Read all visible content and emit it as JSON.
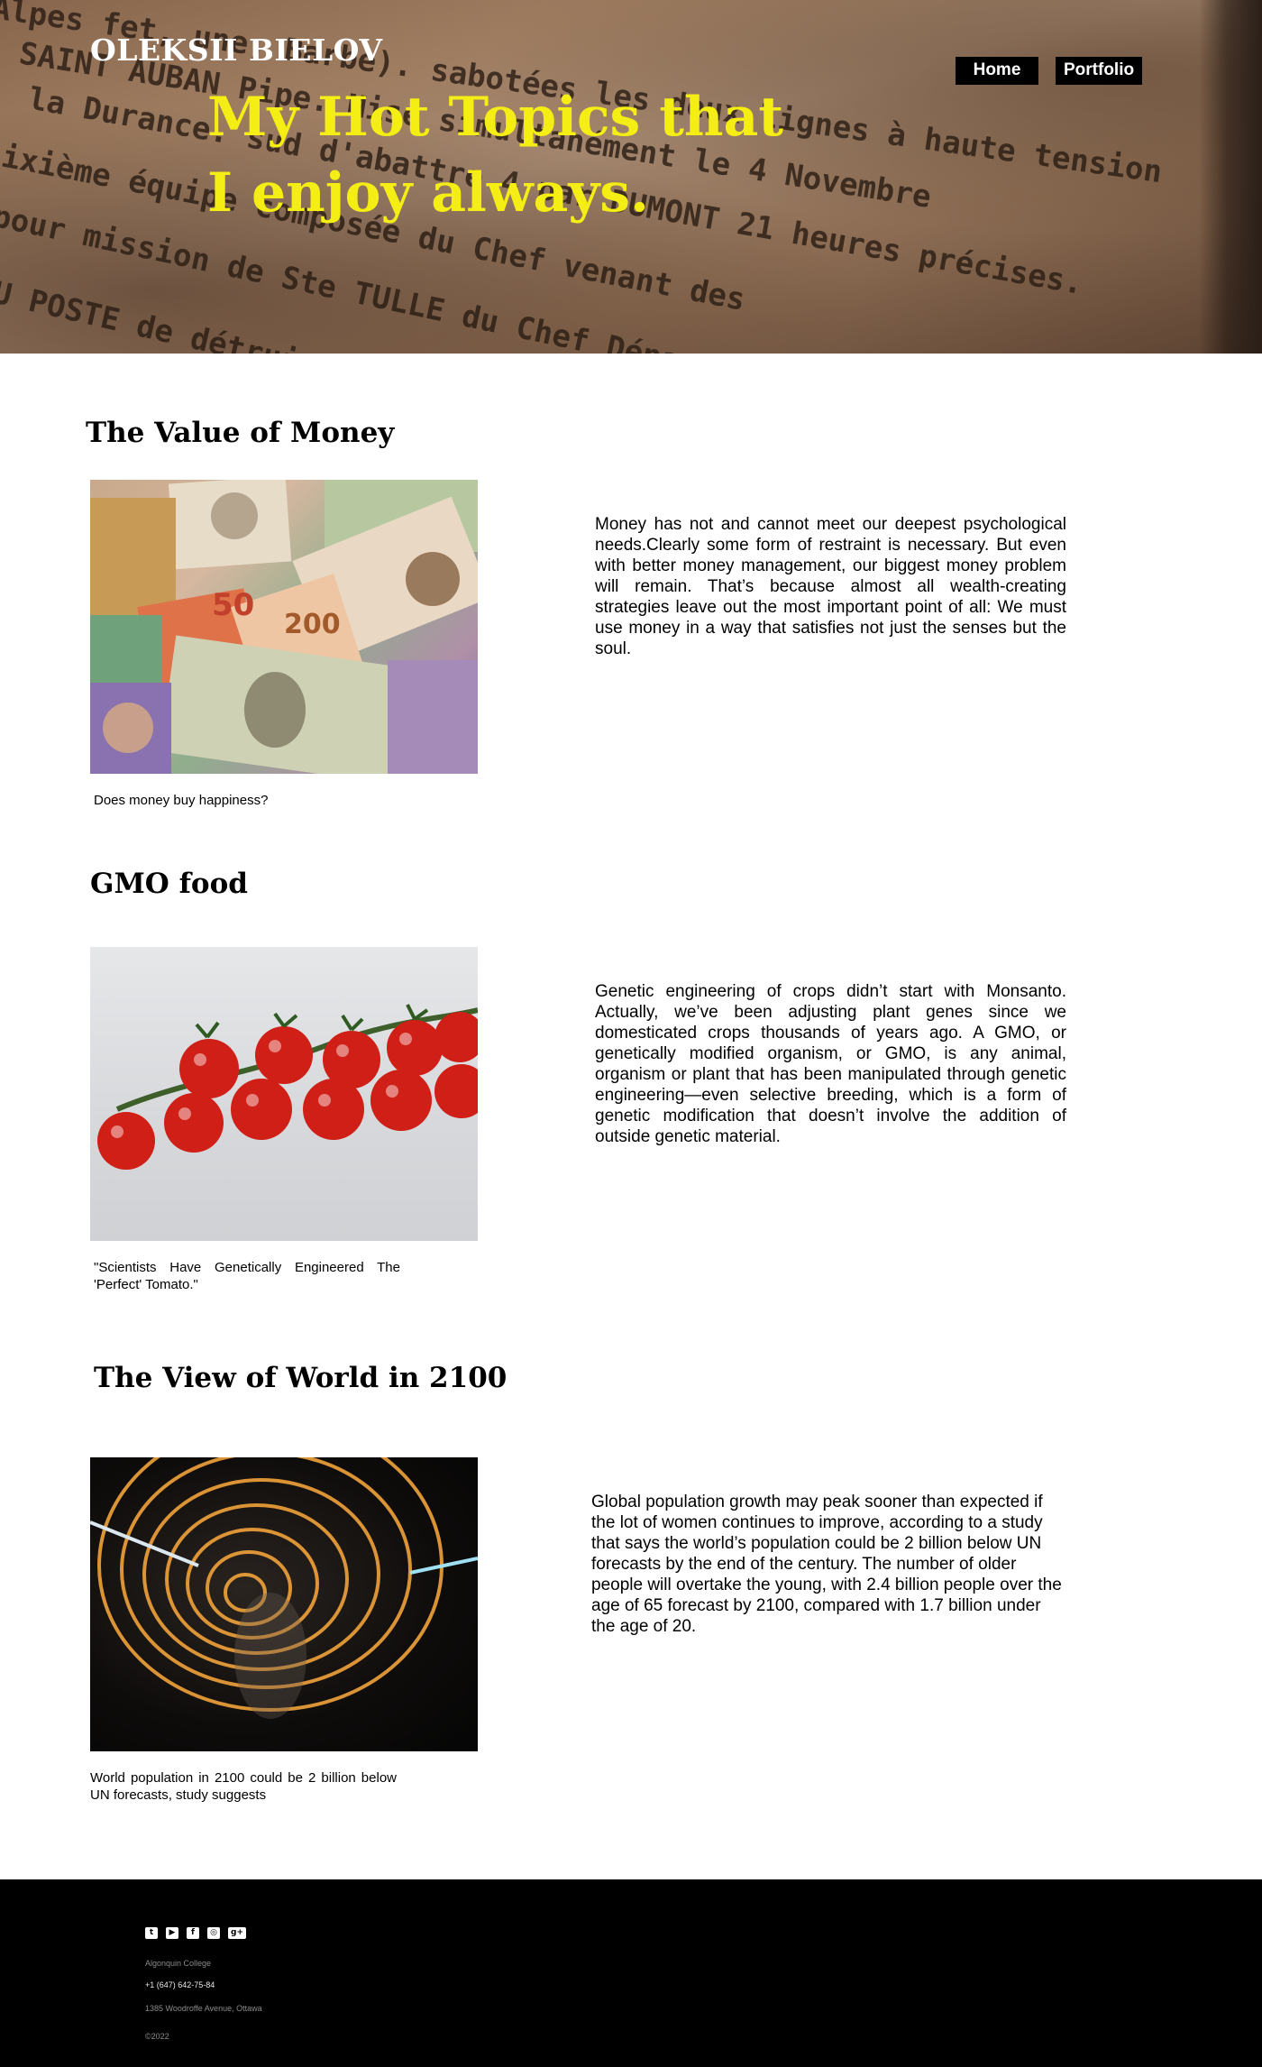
{
  "header": {
    "site_name": "OLEKSII BIELOV",
    "title_line1": "My Hot Topics that",
    "title_line2": "I enjoy always.",
    "background_text": [
      "Alpes fet, une, Barbe). sabotées les deux lignes à haute tension",
      "SAINT AUBAN Pipe. Mise simultanément le 4 Novembre",
      "la Durance. sud d'abattre 4 par DUMONT 21 heures précises.",
      "sixième équipe composée du Chef venant des",
      "pour mission de Ste TULLE du Chef Département sur la ligne",
      "DU POSTE de détruire l'endroit où la ligne"
    ],
    "nav": [
      {
        "label": "Home"
      },
      {
        "label": "Portfolio"
      }
    ],
    "title_color": "#f4ee14"
  },
  "topics": [
    {
      "heading": "The Value of Money",
      "image_name": "money-banknotes-image",
      "caption": "Does money buy happiness?",
      "body": "Money has not and cannot meet our deepest psychological needs.Clearly some form of restraint is necessary. But even with better money management, our biggest money problem will remain. That’s because almost all wealth-creating strategies leave out the most important point of all: We must use money in a way that satisfies not just the senses but the soul."
    },
    {
      "heading": "GMO food",
      "image_name": "cherry-tomatoes-image",
      "caption": "\"Scientists Have Genetically Engineered The 'Perfect' Tomato.\"",
      "body": "Genetic engineering of crops didn’t start with Monsanto. Actually, we’ve been adjusting plant genes since we domesticated crops thousands of years ago. A GMO, or genetically modified organism, or GMO, is any animal, organism or plant that has been manipulated through genetic engineering—even selective breeding, which is a form of genetic modification that doesn’t involve the addition of outside genetic material."
    },
    {
      "heading": "The View of World in 2100",
      "image_name": "light-spiral-image",
      "caption": "World population in 2100 could be 2 billion below UN forecasts, study suggests",
      "body": "Global population growth may peak sooner than expected if the lot of women continues to improve, according to a study that says the world’s population could be 2 billion below UN forecasts by the end of the century. The number of older people will overtake the young, with 2.4 billion people over the age of 65 forecast by 2100, compared with 1.7 billion under the age of 20."
    }
  ],
  "footer": {
    "social_icons": [
      "twitter-icon",
      "youtube-icon",
      "facebook-icon",
      "instagram-icon",
      "google-plus-icon"
    ],
    "institution": "Algonquin College",
    "phone": "+1 (647) 642-75-84",
    "address": "1385 Woodroffe Avenue, Ottawa",
    "copyright": "©2022"
  }
}
